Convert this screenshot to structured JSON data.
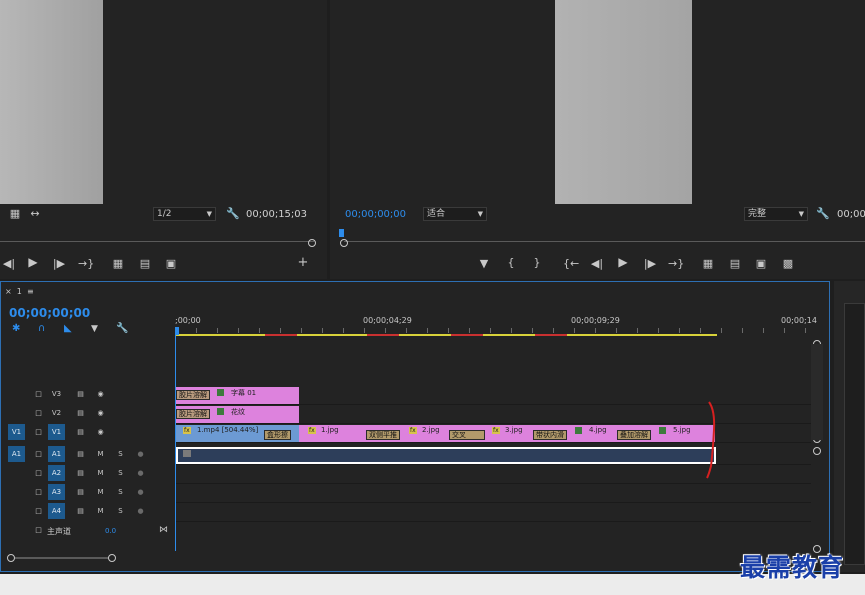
{
  "source_monitor": {
    "fraction": "1/2",
    "timecode": "00;00;15;03"
  },
  "program_monitor": {
    "timecode": "00;00;00;00",
    "fit": "适合",
    "quality": "完整",
    "timecode_right": "00;00"
  },
  "sequence_tab": {
    "close": "×",
    "name": "1",
    "menu": "≡"
  },
  "timeline": {
    "playhead_timecode": "00;00;00;00",
    "ruler": [
      ";00;00",
      "00;00;04;29",
      "00;00;09;29",
      "00;00;14"
    ],
    "tracks": {
      "video": [
        {
          "patch": "",
          "name": "V3"
        },
        {
          "patch": "",
          "name": "V2"
        },
        {
          "patch": "V1",
          "name": "V1"
        }
      ],
      "audio": [
        {
          "patch": "A1",
          "name": "A1"
        },
        {
          "patch": "",
          "name": "A2"
        },
        {
          "patch": "",
          "name": "A3"
        },
        {
          "patch": "",
          "name": "A4"
        }
      ],
      "master_label": "主声道",
      "master_value": "0.0",
      "mute": "M",
      "solo": "S"
    },
    "clips": {
      "v3_transition": "胶片溶解",
      "v3_title": "字幕 01",
      "v2_transition": "胶片溶解",
      "v2_title": "花纹",
      "v1_main": "1.mp4 [504.44%]",
      "v1_transitions": [
        "盒形擦",
        "双侧平推",
        "交叉",
        "带状内滑",
        "叠加溶解"
      ],
      "v1_images": [
        "1.jpg",
        "2.jpg",
        "3.jpg",
        "4.jpg",
        "5.jpg"
      ],
      "fx_label": "fx"
    }
  },
  "watermark": "最需教育",
  "colors": {
    "accent": "#2d8ceb",
    "clip_pink": "#dd82dd",
    "clip_blue": "#6c9ad3",
    "audio_clip": "#2d3e5a"
  }
}
